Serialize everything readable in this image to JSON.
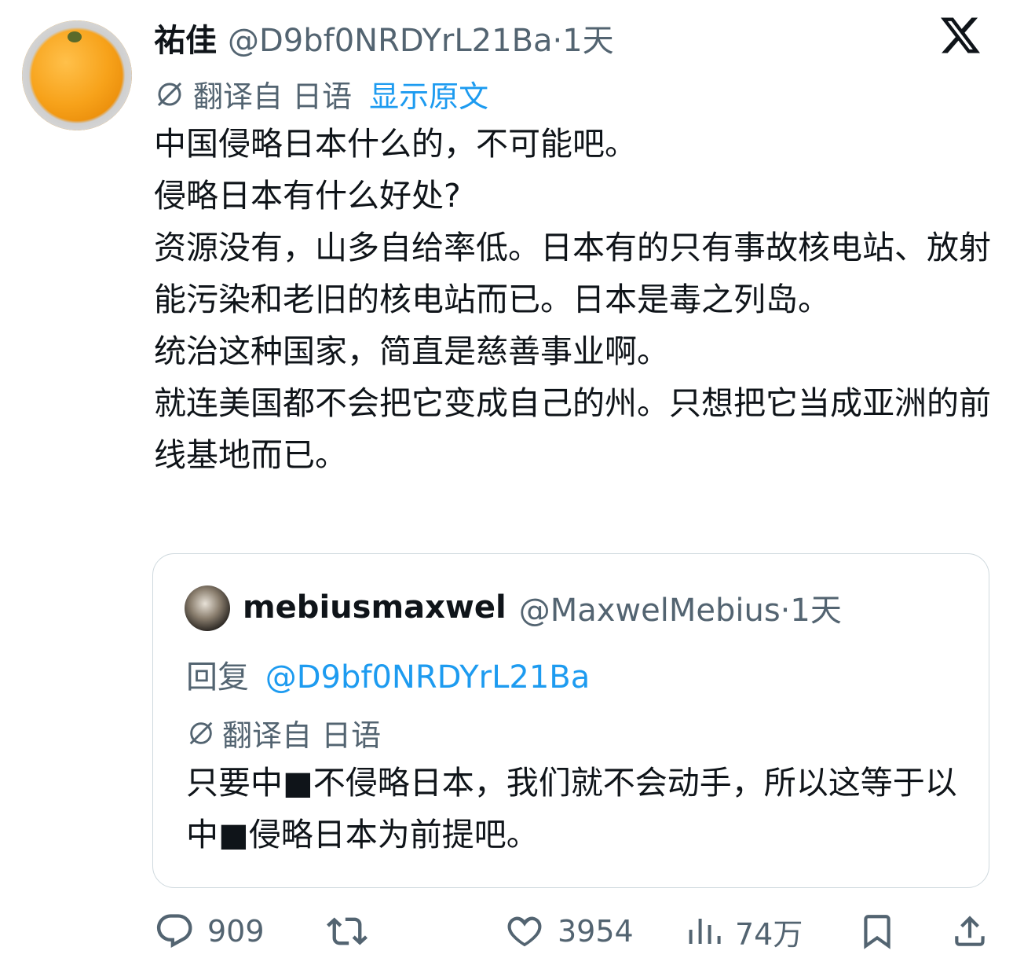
{
  "tweet": {
    "author_name": "祐佳",
    "handle_time": "@D9bf0NRDYrL21Ba·1天",
    "translated_from": "翻译自 日语",
    "show_original": "显示原文",
    "lines": [
      "中国侵略日本什么的，不可能吧。",
      "侵略日本有什么好处?",
      "资源没有，山多自给率低。日本有的只有事故核电站、放射能污染和老旧的核电站而已。日本是毒之列岛。",
      "统治这种国家，简直是慈善事业啊。",
      "就连美国都不会把它变成自己的州。只想把它当成亚洲的前线基地而已。"
    ]
  },
  "quoted": {
    "author_name": "mebiusmaxwel",
    "handle_time": "@MaxwelMebius·1天",
    "reply_label": "回复",
    "reply_to": "@D9bf0NRDYrL21Ba",
    "translated_from": "翻译自 日语",
    "text": "只要中■不侵略日本，我们就不会动手，所以这等于以中■侵略日本为前提吧。"
  },
  "actions": {
    "replies": "909",
    "retweets": "",
    "likes": "3954",
    "views": "74万"
  },
  "colors": {
    "text": "#0f1419",
    "secondary": "#536471",
    "link": "#1d9bf0",
    "border": "#cfd9de"
  },
  "icons": [
    "x-logo-icon",
    "translate-icon",
    "reply-icon",
    "retweet-icon",
    "like-icon",
    "views-icon",
    "bookmark-icon",
    "share-icon"
  ]
}
